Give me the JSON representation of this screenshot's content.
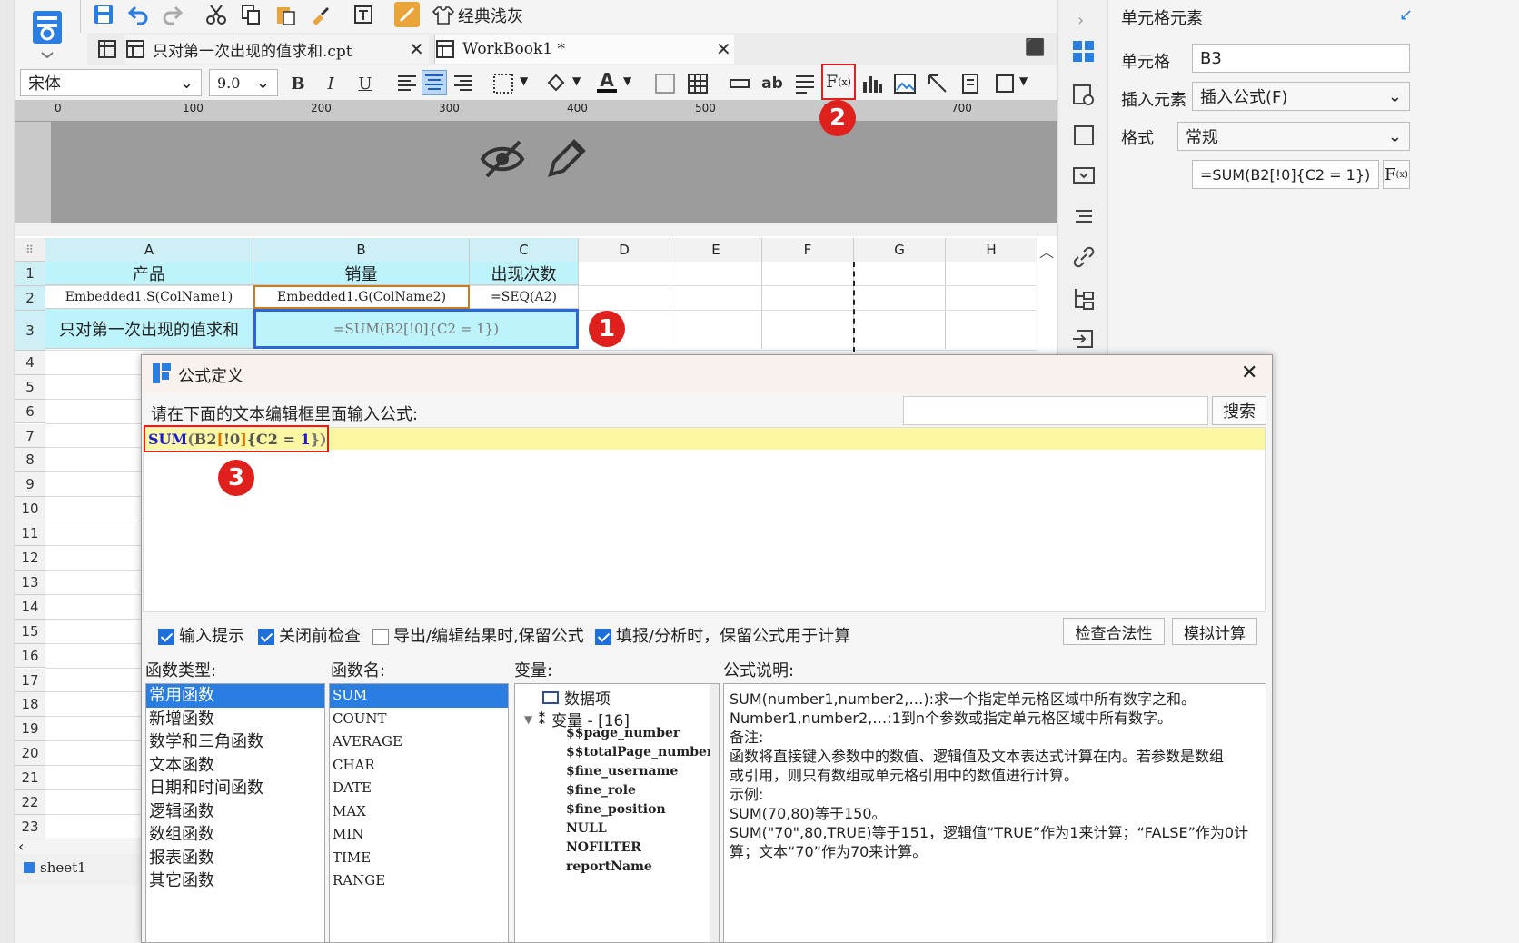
{
  "tabs": [
    {
      "label": "只对第一次出现的值求和.cpt"
    },
    {
      "label": "WorkBook1 *"
    }
  ],
  "toolbar": {
    "theme_label": "经典浅灰",
    "font": "宋体",
    "size": "9.0"
  },
  "ruler": {
    "marks": [
      "0",
      "100",
      "200",
      "300",
      "400",
      "500",
      "600",
      "700"
    ]
  },
  "sheet": {
    "col_headers": [
      "A",
      "B",
      "C",
      "D",
      "E",
      "F",
      "G",
      "H"
    ],
    "row_numbers": [
      "1",
      "2",
      "3",
      "4",
      "5",
      "6",
      "7",
      "8",
      "9",
      "10",
      "11",
      "12",
      "13",
      "14",
      "15",
      "16",
      "17",
      "18",
      "19",
      "20",
      "21",
      "22",
      "23"
    ],
    "a1": "产品",
    "b1": "销量",
    "c1": "出现次数",
    "a2": "Embedded1.S(ColName1)",
    "b2": "Embedded1.G(ColName2)",
    "c2": "=SEQ(A2)",
    "a3": "只对第一次出现的值求和",
    "b3": "=SUM(B2[!0]{C2 = 1})",
    "sheet_tab": "sheet1"
  },
  "badges": {
    "one": "1",
    "two": "2",
    "three": "3"
  },
  "right_panel": {
    "title": "单元格元素",
    "cell_label": "单元格",
    "cell_value": "B3",
    "insert_label": "插入元素",
    "insert_value": "插入公式(F)",
    "format_label": "格式",
    "format_value": "常规",
    "formula_value": "=SUM(B2[!0]{C2 = 1})"
  },
  "dialog": {
    "title": "公式定义",
    "prompt": "请在下面的文本编辑框里面输入公式:",
    "search_btn": "搜索",
    "formula": {
      "fn": "SUM",
      "open": "(",
      "ref": "B2",
      "b1": "[",
      "excl": "!0",
      "b2": "]",
      "cond": "{C2 = ",
      "num": "1",
      "close": "})"
    },
    "checks": [
      {
        "label": "输入提示",
        "checked": true
      },
      {
        "label": "关闭前检查",
        "checked": true
      },
      {
        "label": "导出/编辑结果时,保留公式",
        "checked": false
      },
      {
        "label": "填报/分析时，保留公式用于计算",
        "checked": true
      }
    ],
    "check_btn": "检查合法性",
    "sim_btn": "模拟计算",
    "func_type_label": "函数类型:",
    "func_name_label": "函数名:",
    "var_label": "变量:",
    "desc_label": "公式说明:",
    "func_types": [
      "常用函数",
      "新增函数",
      "数学和三角函数",
      "文本函数",
      "日期和时间函数",
      "逻辑函数",
      "数组函数",
      "报表函数",
      "其它函数"
    ],
    "func_names": [
      "SUM",
      "COUNT",
      "AVERAGE",
      "CHAR",
      "DATE",
      "MAX",
      "MIN",
      "TIME",
      "RANGE"
    ],
    "vars": {
      "data_item": "数据项",
      "var_group": "变量 - [16]",
      "items": [
        "$$page_number",
        "$$totalPage_number",
        "$fine_username",
        "$fine_role",
        "$fine_position",
        "NULL",
        "NOFILTER",
        "reportName"
      ]
    },
    "desc": [
      "SUM(number1,number2,…):求一个指定单元格区域中所有数字之和。",
      "Number1,number2,…:1到n个参数或指定单元格区域中所有数字。",
      "备注:",
      "函数将直接键入参数中的数值、逻辑值及文本表达式计算在内。若参数是数组",
      "或引用，则只有数组或单元格引用中的数值进行计算。",
      "示例:",
      "SUM(70,80)等于150。",
      "SUM(\"70\",80,TRUE)等于151，逻辑值“TRUE”作为1来计算；“FALSE”作为0计",
      "算；文本“70”作为70来计算。"
    ]
  }
}
